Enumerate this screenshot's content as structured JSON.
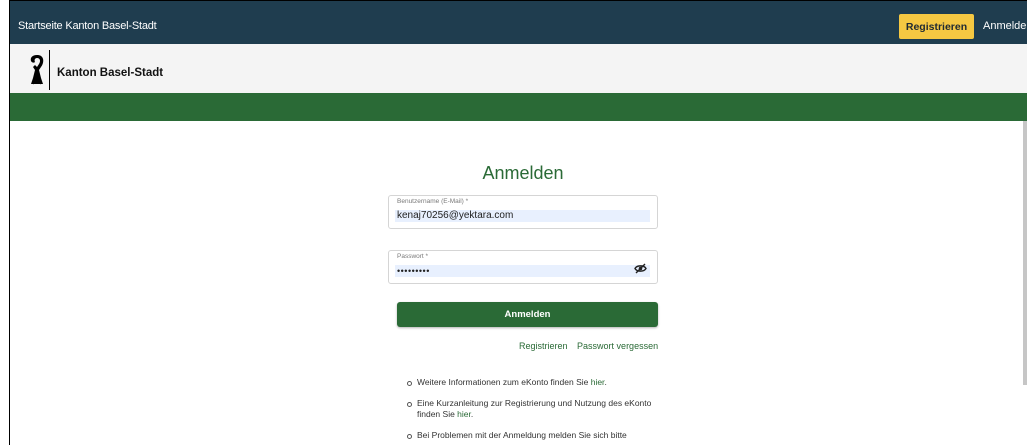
{
  "topbar": {
    "home_link": "Startseite Kanton Basel-Stadt",
    "register_button": "Registrieren",
    "login_link": "Anmelden"
  },
  "brand": {
    "name": "Kanton Basel-Stadt",
    "logo_icon": "basel-crosier-icon"
  },
  "colors": {
    "topbar": "#1f3d4f",
    "accent_green": "#2a6a36",
    "register_yellow": "#f5c842"
  },
  "form": {
    "title": "Anmelden",
    "username_label": "Benutzername (E-Mail) *",
    "username_value": "kenaj70256@yektara.com",
    "password_label": "Passwort *",
    "password_value": "•••••••••",
    "password_toggle_icon": "eye-off-icon",
    "submit_label": "Anmelden",
    "register_link": "Registrieren",
    "forgot_link": "Passwort vergessen"
  },
  "info": {
    "item1_text": "Weitere Informationen zum eKonto finden Sie ",
    "item1_link": "hier",
    "item1_end": ".",
    "item2_text": "Eine Kurzanleitung zur Registrierung und Nutzung des eKonto finden Sie ",
    "item2_link": "hier",
    "item2_end": ".",
    "item3_text": "Bei Problemen mit der Anmeldung melden Sie sich bitte"
  }
}
